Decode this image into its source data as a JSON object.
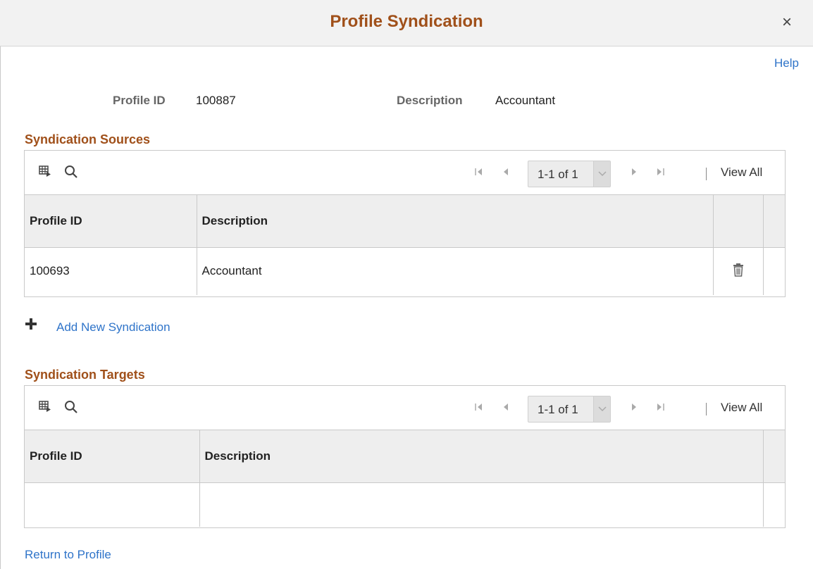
{
  "dialog": {
    "title": "Profile Syndication",
    "close_symbol": "×"
  },
  "help_link": "Help",
  "profile": {
    "id_label": "Profile ID",
    "id_value": "100887",
    "description_label": "Description",
    "description_value": "Accountant"
  },
  "sources": {
    "title": "Syndication Sources",
    "pager_text": "1-1 of 1",
    "view_all": "View All",
    "columns": [
      "Profile ID",
      "Description"
    ],
    "rows": [
      {
        "profile_id": "100693",
        "description": "Accountant"
      }
    ]
  },
  "add_link": "Add New Syndication",
  "targets": {
    "title": "Syndication Targets",
    "pager_text": "1-1 of 1",
    "view_all": "View All",
    "columns": [
      "Profile ID",
      "Description"
    ],
    "rows": [
      {
        "profile_id": "",
        "description": ""
      }
    ]
  },
  "return_link": "Return to Profile",
  "icons": {
    "personalize": "grid-personalize-icon",
    "find": "search-icon",
    "first": "first-page-icon",
    "prev": "previous-page-icon",
    "next": "next-page-icon",
    "last": "last-page-icon",
    "delete": "trash-icon",
    "add": "plus-icon",
    "close": "close-icon"
  },
  "colors": {
    "title": "#a0501a",
    "link": "#2f74c9",
    "header_bg": "#f2f2f2",
    "grid_header_bg": "#eeeeee",
    "border": "#c9c9c9"
  }
}
